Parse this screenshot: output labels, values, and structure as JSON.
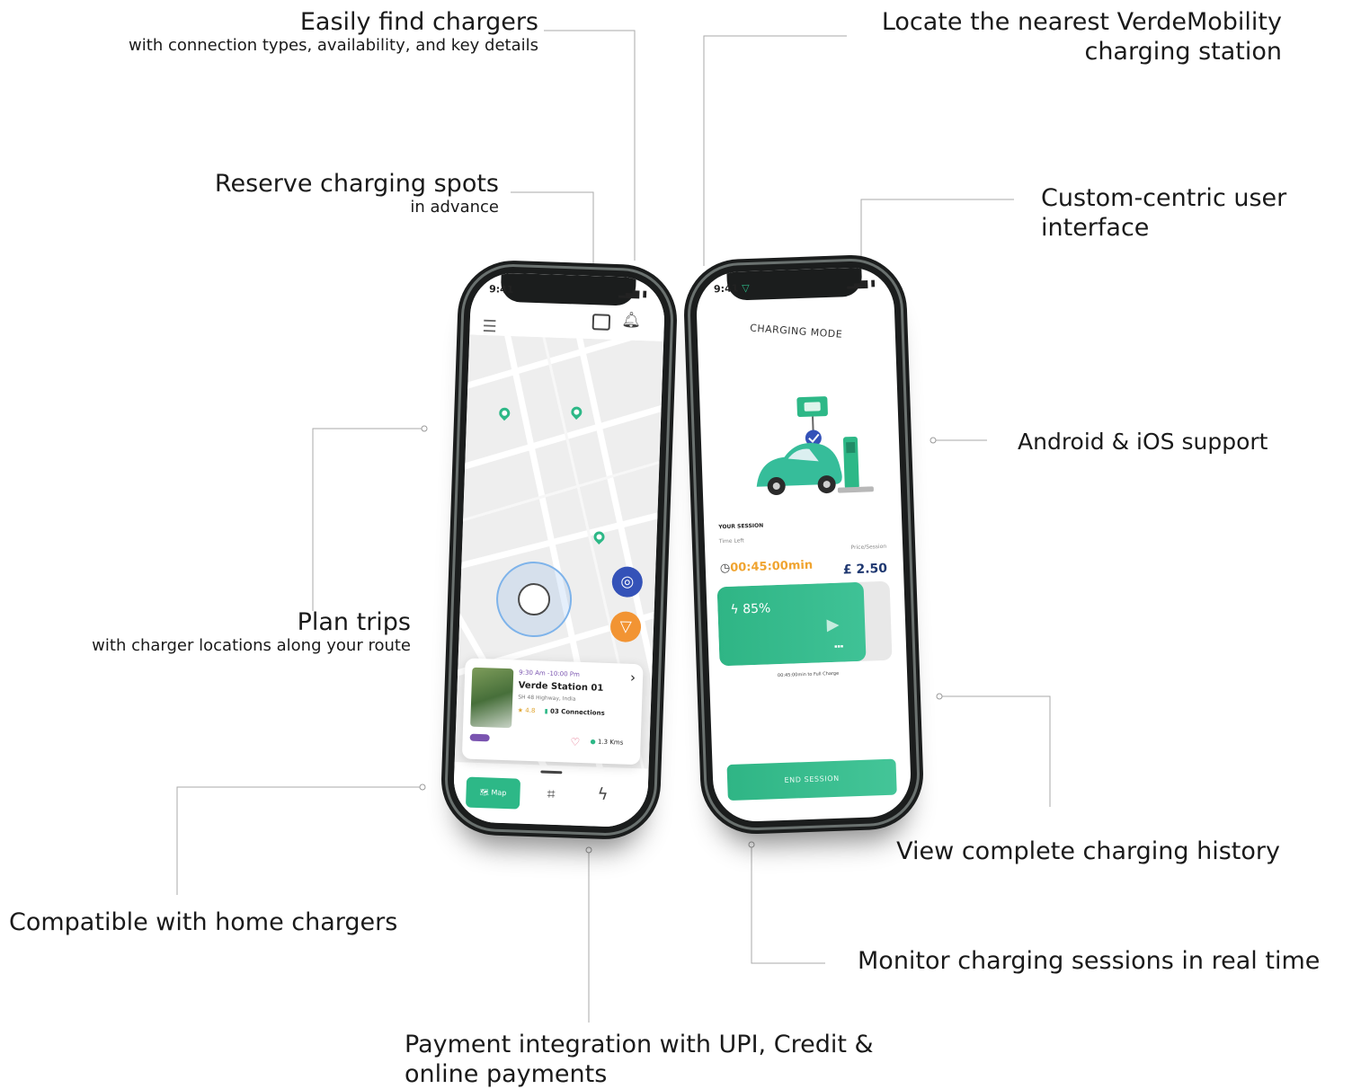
{
  "callouts": {
    "find_chargers": {
      "title": "Easily find chargers",
      "subtitle": "with connection types, availability, and key details"
    },
    "reserve": {
      "title": "Reserve charging spots",
      "subtitle": "in advance"
    },
    "plan_trips": {
      "title": "Plan trips",
      "subtitle": "with charger locations along your route"
    },
    "home_chargers": {
      "title": "Compatible with home chargers"
    },
    "payment": {
      "title_line1": "Payment integration with UPI, Credit &",
      "title_line2": "online payments"
    },
    "nearest_station": {
      "title_line1": "Locate the nearest VerdeMobility",
      "title_line2": "charging station"
    },
    "custom_ui": {
      "title_line1": "Custom-centric user",
      "title_line2": "interface"
    },
    "platforms": {
      "title": "Android & iOS support"
    },
    "history": {
      "title": "View complete charging history"
    },
    "monitor": {
      "title": "Monitor charging sessions in real time"
    }
  },
  "map_phone": {
    "status_time": "9:41",
    "station": {
      "hours": "9:30 Am -10:00 Pm",
      "name": "Verde Station 01",
      "address": "SH 48 Highway, India",
      "rating": "4.8",
      "connections": "03 Connections",
      "distance": "1.3 Kms"
    },
    "nav": {
      "map_label": "Map"
    }
  },
  "charging_phone": {
    "status_time": "9:41",
    "title": "CHARGING MODE",
    "session_label": "YOUR SESSION",
    "time_left_label": "Time Left",
    "time_left_value": "00:45:00min",
    "price_label": "Price/Session",
    "price_value": "£ 2.50",
    "charge_percent_label": "85%",
    "charge_fraction": 0.85,
    "charge_note": "00:45:00min to Full Charge",
    "end_session_label": "END SESSION"
  },
  "colors": {
    "accent_green": "#2db887",
    "locate_blue": "#3452b8",
    "filter_orange": "#f29433",
    "time_orange": "#f0a430",
    "price_navy": "#1e3770"
  }
}
